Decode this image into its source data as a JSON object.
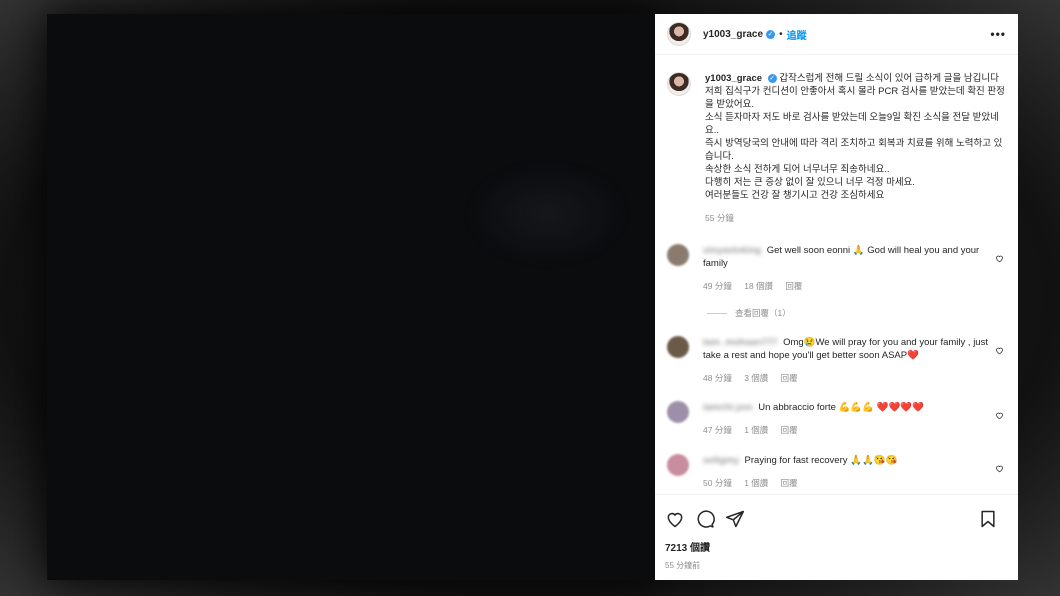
{
  "post": {
    "username": "y1003_grace",
    "follow_label": "追蹤",
    "more_label": "•••",
    "caption_username": "y1003_grace",
    "caption_lines": [
      "갑작스럽게 전해 드릴 소식이 있어 급하게 글을 남깁니다",
      "저희 집식구가 컨디션이 안좋아서 혹시 몰라 PCR 검사를 받았는데 확진 판정을 받았어요.",
      "소식 듣자마자 저도 바로 검사를 받았는데 오늘9일 확진 소식을 전달 받았네요..",
      "즉시 방역당국의 안내에 따라 격리 조치하고 회복과 치료를 위해 노력하고 있습니다.",
      "속상한 소식 전하게 되어 너무너무 죄송하네요..",
      "다행히 저는 큰 증상 없이 잘 있으니 너무 걱정 마세요.",
      "여러분들도 건강 잘 챙기시고 건강 조심하세요"
    ],
    "caption_time": "55 分鐘"
  },
  "comments": [
    {
      "username_blurred": "xinyantvking",
      "text": "Get well soon eonni 🙏 God will heal you and your family",
      "time": "49 分鐘",
      "likes": "18 個讚",
      "reply": "回覆",
      "view_replies": "查看回覆（1）",
      "avatar_color": "#8a7b6e"
    },
    {
      "username_blurred": "tam_mohaan777",
      "text": "Omg😢We will pray for you and your family , just take a rest and hope you'll get better soon ASAP❤️",
      "time": "48 分鐘",
      "likes": "3 個讚",
      "reply": "回覆",
      "avatar_color": "#6b5a48"
    },
    {
      "username_blurred": "iamchi.yoo",
      "text": "Un abbraccio forte 💪💪💪 ❤️❤️❤️❤️",
      "time": "47 分鐘",
      "likes": "1 個讚",
      "reply": "回覆",
      "avatar_color": "#9d8fa8"
    },
    {
      "username_blurred": "seltgmy",
      "text": "Praying for fast recovery 🙏🙏😘😘",
      "time": "50 分鐘",
      "likes": "1 個讚",
      "reply": "回覆",
      "avatar_color": "#c98da0"
    }
  ],
  "footer": {
    "likes": "7213 個讚",
    "time_ago": "55 分鐘前"
  }
}
